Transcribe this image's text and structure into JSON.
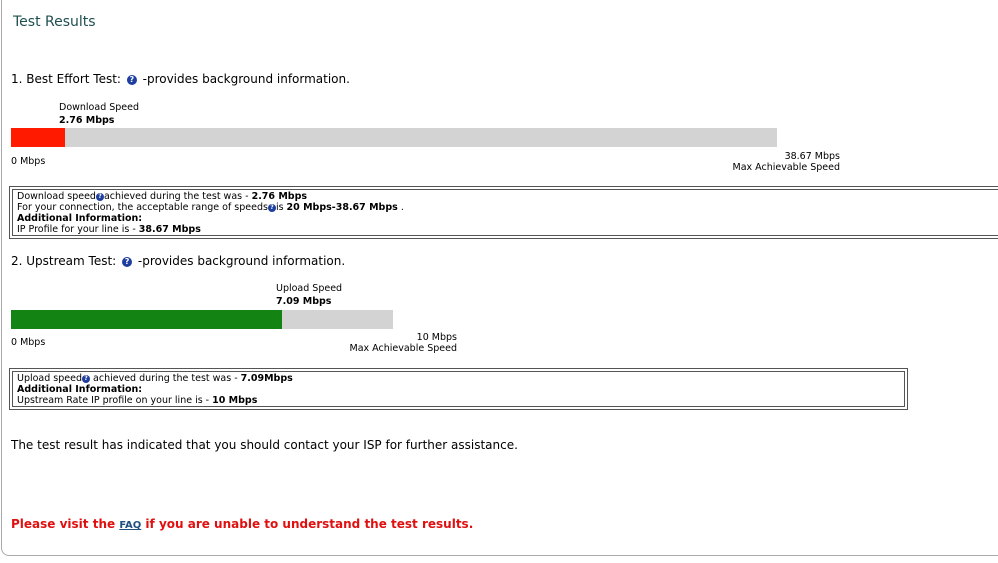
{
  "page": {
    "title": "Test Results"
  },
  "icons": {
    "help": "question-mark-icon",
    "help_glyph": "?"
  },
  "download": {
    "heading_prefix": "1. Best Effort Test:",
    "heading_suffix": "-provides background information.",
    "speed_label": "Download Speed",
    "speed_value": "2.76 Mbps",
    "min_label": "0 Mbps",
    "max_value": "38.67 Mbps",
    "max_label": "Max Achievable Speed",
    "fill_fraction": 0.071,
    "fill_color": "#ff1a00",
    "info": {
      "line1_prefix": "Download speed",
      "line1_mid": "achieved during the test was - ",
      "line1_value": "2.76 Mbps",
      "line2_prefix": "For your connection, the acceptable range of speeds",
      "line2_mid": "is ",
      "line2_value": "20 Mbps-38.67 Mbps",
      "line2_suffix": " .",
      "additional": "Additional Information:",
      "line4_prefix": "IP Profile for your line is - ",
      "line4_value": "38.67 Mbps"
    }
  },
  "upload": {
    "heading_prefix": "2. Upstream Test:",
    "heading_suffix": "-provides background information.",
    "speed_label": "Upload Speed",
    "speed_value": "7.09 Mbps",
    "min_label": "0 Mbps",
    "max_value": "10 Mbps",
    "max_label": "Max Achievable Speed",
    "fill_fraction": 0.709,
    "fill_color": "#138313",
    "info": {
      "line1_prefix": "Upload speed",
      "line1_mid": " achieved during the test was - ",
      "line1_value": "7.09Mbps",
      "additional": "Additional Information:",
      "line3_prefix": "Upstream Rate IP profile on your line is - ",
      "line3_value": "10 Mbps"
    }
  },
  "result_message": "The test result has indicated that you should contact your ISP for further assistance.",
  "faq": {
    "prefix": "Please visit the ",
    "link": "FAQ",
    "suffix": " if you are unable to understand the test results."
  },
  "colors": {
    "title": "#1f4f4f",
    "warning": "#e01010",
    "bar_background": "#d3d3d3"
  }
}
